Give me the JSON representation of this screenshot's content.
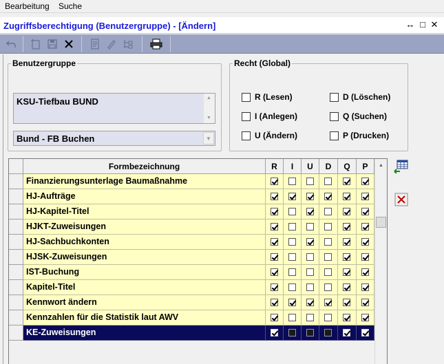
{
  "menu": {
    "items": [
      "Bearbeitung",
      "Suche"
    ]
  },
  "window": {
    "title": "Zugriffsberechtigung (Benutzergruppe)  - [Ändern]",
    "controls": [
      "↔",
      "□",
      "✕"
    ]
  },
  "toolbar": {
    "buttons": [
      "undo-icon",
      "new-record-icon",
      "save-icon",
      "delete-icon",
      "report-icon",
      "edit-icon",
      "tree-icon",
      "print-icon"
    ]
  },
  "benutzergruppe": {
    "legend": "Benutzergruppe",
    "memo_value": "KSU-Tiefbau BUND",
    "combo_value": "Bund - FB Buchen"
  },
  "recht_global": {
    "legend": "Recht (Global)",
    "options": [
      {
        "label": "R (Lesen)",
        "checked": false
      },
      {
        "label": "D (Löschen)",
        "checked": false
      },
      {
        "label": "I (Anlegen)",
        "checked": false
      },
      {
        "label": "Q (Suchen)",
        "checked": false
      },
      {
        "label": "U (Ändern)",
        "checked": false
      },
      {
        "label": "P (Drucken)",
        "checked": false
      }
    ]
  },
  "grid": {
    "headers": {
      "name": "Formbezeichnung",
      "flags": [
        "R",
        "I",
        "U",
        "D",
        "Q",
        "P"
      ]
    },
    "rows": [
      {
        "name": "Finanzierungsunterlage Baumaßnahme",
        "flags": [
          true,
          false,
          false,
          false,
          true,
          true
        ]
      },
      {
        "name": "HJ-Aufträge",
        "flags": [
          true,
          true,
          true,
          true,
          true,
          true
        ]
      },
      {
        "name": "HJ-Kapitel-Titel",
        "flags": [
          true,
          false,
          true,
          false,
          true,
          true
        ]
      },
      {
        "name": "HJKT-Zuweisungen",
        "flags": [
          true,
          false,
          false,
          false,
          true,
          true
        ]
      },
      {
        "name": "HJ-Sachbuchkonten",
        "flags": [
          true,
          false,
          true,
          false,
          true,
          true
        ]
      },
      {
        "name": "HJSK-Zuweisungen",
        "flags": [
          true,
          false,
          false,
          false,
          true,
          true
        ]
      },
      {
        "name": "IST-Buchung",
        "flags": [
          true,
          false,
          false,
          false,
          true,
          true
        ]
      },
      {
        "name": "Kapitel-Titel",
        "flags": [
          true,
          false,
          false,
          false,
          true,
          true
        ]
      },
      {
        "name": "Kennwort ändern",
        "flags": [
          true,
          true,
          true,
          true,
          true,
          true
        ]
      },
      {
        "name": "Kennzahlen für die Statistik laut AWV",
        "flags": [
          true,
          false,
          false,
          false,
          true,
          true
        ]
      },
      {
        "name": "KE-Zuweisungen",
        "flags": [
          true,
          false,
          false,
          false,
          true,
          true
        ],
        "selected": true
      }
    ]
  }
}
